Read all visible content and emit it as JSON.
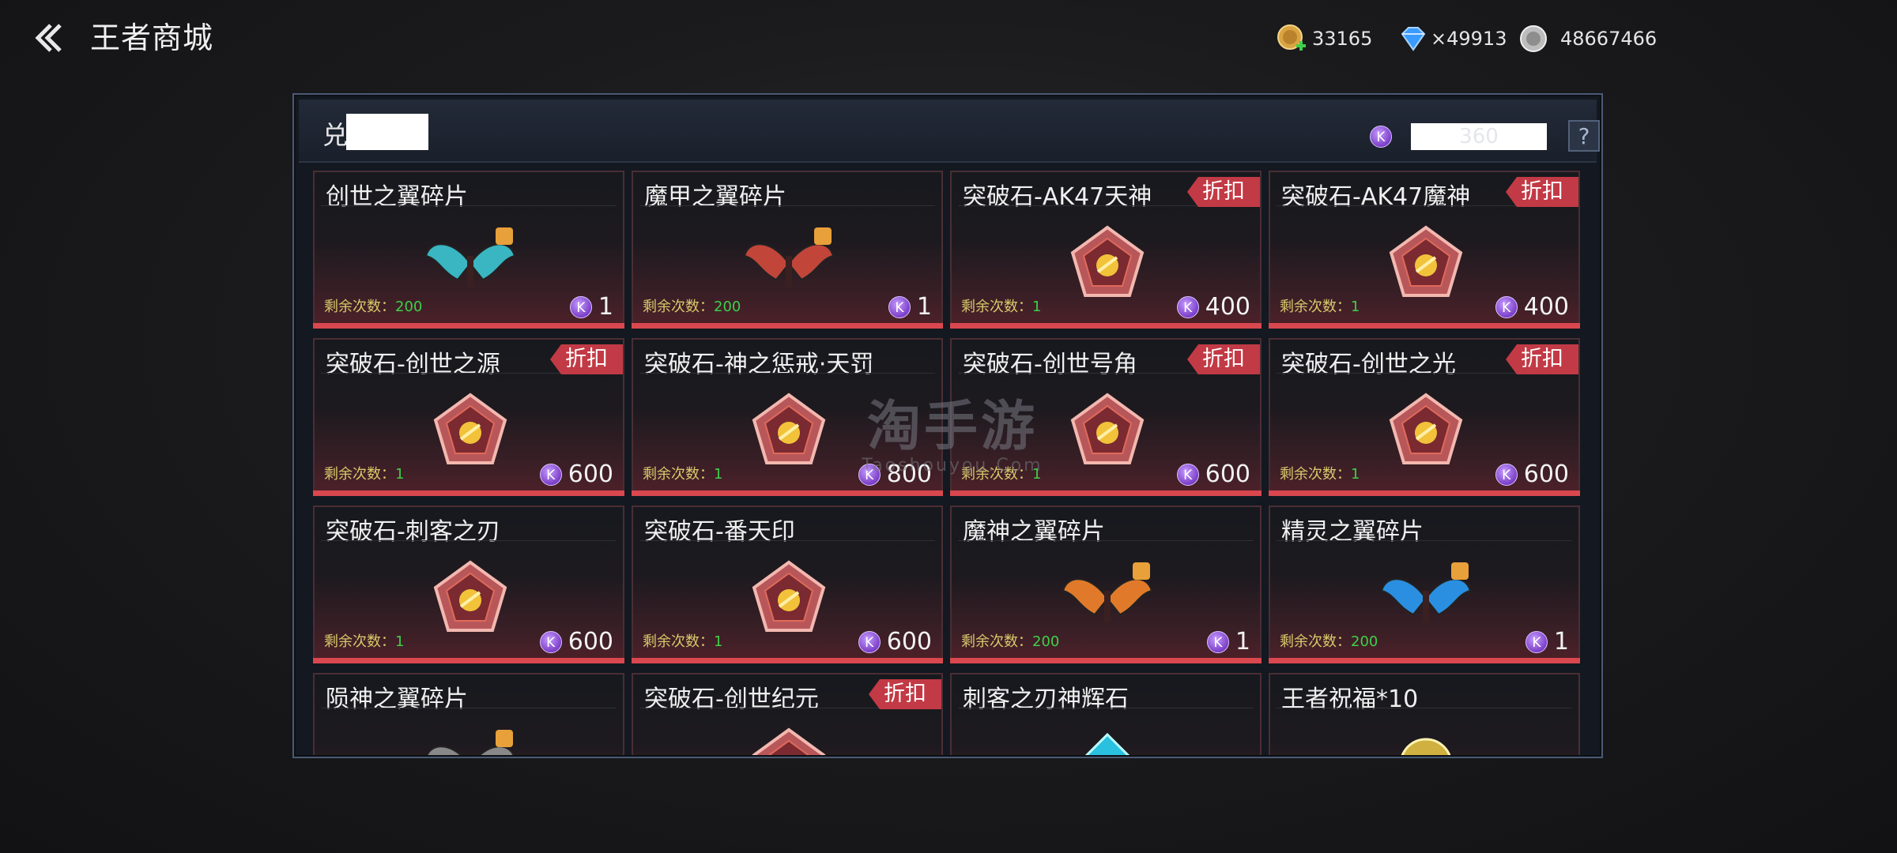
{
  "header": {
    "title": "王者商城"
  },
  "currencies": [
    {
      "icon": "gold-coin-icon",
      "value": "33165"
    },
    {
      "icon": "diamond-icon",
      "value": "49913"
    },
    {
      "icon": "silver-coin-icon",
      "value": "48667466"
    }
  ],
  "panel": {
    "title": "兑换",
    "balance": "360",
    "help": "?"
  },
  "labels": {
    "remaining_prefix": "剩余次数：",
    "discount": "折扣",
    "coin": "K"
  },
  "items": [
    {
      "name": "创世之翼碎片",
      "remaining": "200",
      "price": "1",
      "discount": false,
      "icon": "wings-fragment-icon",
      "color": "#3ab5c2"
    },
    {
      "name": "魔甲之翼碎片",
      "remaining": "200",
      "price": "1",
      "discount": false,
      "icon": "wings-fragment-icon",
      "color": "#c2453a"
    },
    {
      "name": "突破石-AK47天神",
      "remaining": "1",
      "price": "400",
      "discount": true,
      "icon": "breakthrough-stone-icon",
      "color": "#e06a5a"
    },
    {
      "name": "突破石-AK47魔神",
      "remaining": "1",
      "price": "400",
      "discount": true,
      "icon": "breakthrough-stone-icon",
      "color": "#e06a5a"
    },
    {
      "name": "突破石-创世之源",
      "remaining": "1",
      "price": "600",
      "discount": true,
      "icon": "breakthrough-stone-icon",
      "color": "#e06a5a"
    },
    {
      "name": "突破石-神之惩戒·天罚",
      "remaining": "1",
      "price": "800",
      "discount": false,
      "icon": "breakthrough-stone-icon",
      "color": "#e06a5a"
    },
    {
      "name": "突破石-创世号角",
      "remaining": "1",
      "price": "600",
      "discount": true,
      "icon": "breakthrough-stone-icon",
      "color": "#e06a5a"
    },
    {
      "name": "突破石-创世之光",
      "remaining": "1",
      "price": "600",
      "discount": true,
      "icon": "breakthrough-stone-icon",
      "color": "#e06a5a"
    },
    {
      "name": "突破石-刺客之刃",
      "remaining": "1",
      "price": "600",
      "discount": false,
      "icon": "breakthrough-stone-icon",
      "color": "#e06a5a"
    },
    {
      "name": "突破石-番天印",
      "remaining": "1",
      "price": "600",
      "discount": false,
      "icon": "breakthrough-stone-icon",
      "color": "#e06a5a"
    },
    {
      "name": "魔神之翼碎片",
      "remaining": "200",
      "price": "1",
      "discount": false,
      "icon": "wings-fragment-icon",
      "color": "#e07a2a"
    },
    {
      "name": "精灵之翼碎片",
      "remaining": "200",
      "price": "1",
      "discount": false,
      "icon": "wings-fragment-icon",
      "color": "#2a8fe0"
    },
    {
      "name": "陨神之翼碎片",
      "remaining": "",
      "price": "",
      "discount": false,
      "icon": "wings-fragment-icon",
      "color": "#888888"
    },
    {
      "name": "突破石-创世纪元",
      "remaining": "",
      "price": "",
      "discount": true,
      "icon": "breakthrough-stone-icon",
      "color": "#e06a5a"
    },
    {
      "name": "刺客之刃神辉石",
      "remaining": "",
      "price": "",
      "discount": false,
      "icon": "gem-icon",
      "color": "#2ac0e0"
    },
    {
      "name": "王者祝福*10",
      "remaining": "",
      "price": "",
      "discount": false,
      "icon": "blessing-icon",
      "color": "#d0b040"
    }
  ],
  "watermark": {
    "main": "淘手游",
    "sub": "Taoshouyou.Com"
  }
}
